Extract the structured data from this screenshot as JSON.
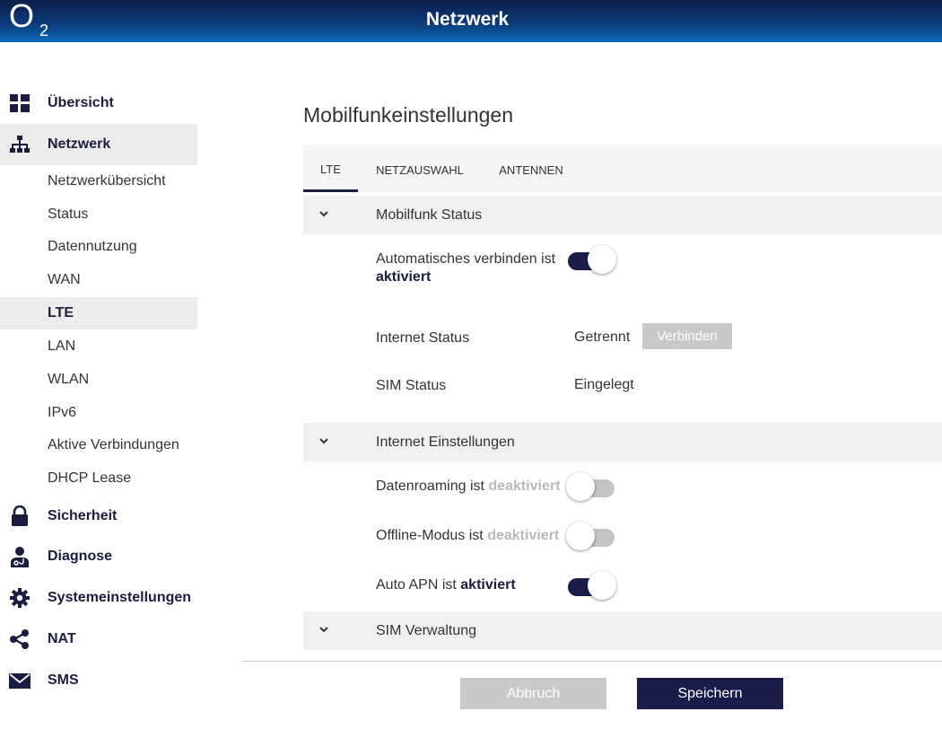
{
  "header": {
    "logo_text": "O",
    "logo_sub": "2",
    "title": "Netzwerk"
  },
  "sidebar": {
    "main_items": [
      {
        "label": "Übersicht",
        "icon": "dashboard-grid-icon"
      },
      {
        "label": "Netzwerk",
        "icon": "network-tree-icon",
        "active": true
      },
      {
        "label": "Sicherheit",
        "icon": "lock-icon"
      },
      {
        "label": "Diagnose",
        "icon": "doctor-icon"
      },
      {
        "label": "Systemeinstellungen",
        "icon": "gear-icon"
      },
      {
        "label": "NAT",
        "icon": "share-icon"
      },
      {
        "label": "SMS",
        "icon": "envelope-icon"
      }
    ],
    "network_sub_items": [
      {
        "label": "Netzwerkübersicht"
      },
      {
        "label": "Status"
      },
      {
        "label": "Datennutzung"
      },
      {
        "label": "WAN"
      },
      {
        "label": "LTE",
        "active": true
      },
      {
        "label": "LAN"
      },
      {
        "label": "WLAN"
      },
      {
        "label": "IPv6"
      },
      {
        "label": "Aktive Verbindungen"
      },
      {
        "label": "DHCP Lease"
      }
    ]
  },
  "main": {
    "title": "Mobilfunkeinstellungen",
    "tabs": [
      {
        "label": "LTE",
        "active": true
      },
      {
        "label": "NETZAUSWAHL"
      },
      {
        "label": "ANTENNEN"
      }
    ],
    "sections": {
      "mobilfunk_status": {
        "title": "Mobilfunk Status",
        "auto_connect": {
          "label": "Automatisches verbinden ist",
          "state_text": "aktiviert",
          "on": true
        },
        "internet_status": {
          "label": "Internet Status",
          "value": "Getrennt",
          "button": "Verbinden"
        },
        "sim_status": {
          "label": "SIM Status",
          "value": "Eingelegt"
        }
      },
      "internet_einstellungen": {
        "title": "Internet Einstellungen",
        "datenroaming": {
          "label": "Datenroaming ist",
          "state_text": "deaktiviert",
          "on": false
        },
        "offline_modus": {
          "label": "Offline-Modus ist",
          "state_text": "deaktiviert",
          "on": false
        },
        "auto_apn": {
          "label": "Auto APN ist",
          "state_text": "aktiviert",
          "on": true
        }
      },
      "sim_verwaltung": {
        "title": "SIM Verwaltung"
      }
    }
  },
  "footer": {
    "cancel_label": "Abbruch",
    "save_label": "Speichern"
  },
  "colors": {
    "brand_navy": "#1a1d4a",
    "header_gradient_top": "#0d1e4a",
    "header_gradient_bottom": "#0a6cb8",
    "disabled_gray": "#c9c9c9",
    "active_bg": "#ececec"
  }
}
